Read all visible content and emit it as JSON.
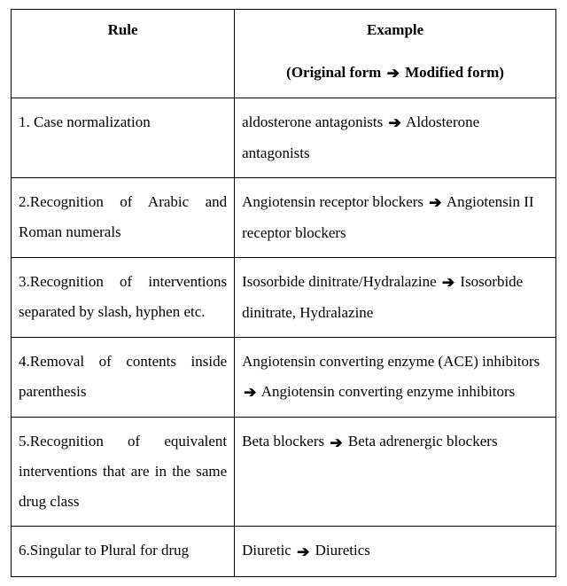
{
  "headers": {
    "rule": "Rule",
    "example": "Example",
    "example_sub_prefix": "(Original form ",
    "example_sub_suffix": " Modified form)"
  },
  "arrow": "➔",
  "rows": [
    {
      "rule": "1. Case normalization",
      "example_before": "aldosterone antagonists ",
      "example_after": " Aldosterone antagonists"
    },
    {
      "rule": "2.Recognition of Arabic and Roman numerals",
      "example_before": "Angiotensin receptor blockers ",
      "example_after": " Angiotensin II receptor blockers"
    },
    {
      "rule": "3.Recognition of interventions separated by slash, hyphen etc.",
      "example_before": "Isosorbide dinitrate/Hydralazine ",
      "example_after": " Isosorbide dinitrate, Hydralazine"
    },
    {
      "rule": "4.Removal of contents inside parenthesis",
      "example_before": "Angiotensin converting enzyme (ACE) inhibitors ",
      "example_after": " Angiotensin converting enzyme inhibitors"
    },
    {
      "rule": "5.Recognition of equivalent interventions that are in the same drug class",
      "example_before": "Beta blockers ",
      "example_after": " Beta adrenergic blockers"
    },
    {
      "rule": "6.Singular to Plural for drug",
      "example_before": "Diuretic ",
      "example_after": " Diuretics"
    }
  ]
}
